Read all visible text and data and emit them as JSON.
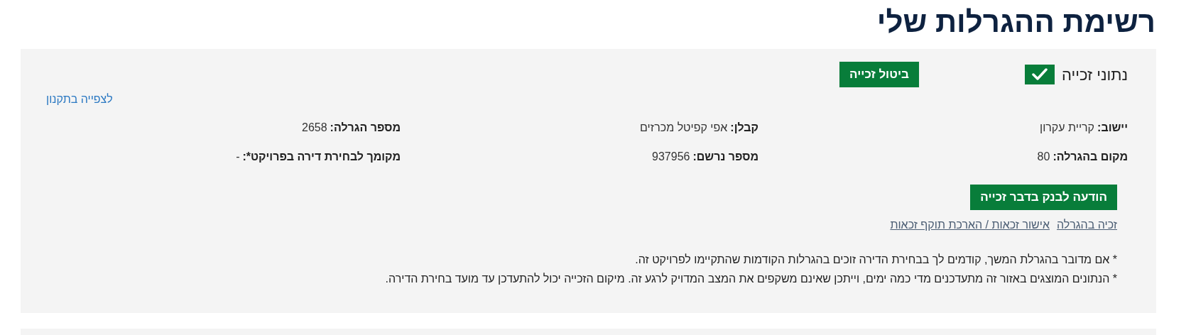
{
  "page_title": "רשימת ההגרלות שלי",
  "win_details": {
    "label": "נתוני זכייה",
    "checked": true
  },
  "cancel_button": "ביטול זכייה",
  "regulations_link": "לצפייה בתקנון",
  "fields": [
    {
      "label": "יישוב:",
      "value": "קריית עקרון"
    },
    {
      "label": "קבלן:",
      "value": "אפי קפיטל מכרזים"
    },
    {
      "label": "מספר הגרלה:",
      "value": "2658"
    },
    {
      "label": "מקום בהגרלה:",
      "value": "80"
    },
    {
      "label": "מספר נרשם:",
      "value": "937956"
    },
    {
      "label": "מקומך לבחירת דירה בפרויקט*:",
      "value": "-"
    }
  ],
  "bank_button": "הודעה לבנק בדבר זכייה",
  "links": [
    "זכיה בהגרלה",
    "אישור זכאות / הארכת תוקף זכאות"
  ],
  "notes": [
    "* אם מדובר בהגרלת המשך, קודמים לך בבחירת הדירה זוכים בהגרלות הקודמות שהתקיימו לפרויקט זה.",
    "* הנתונים המוצגים באזור זה מתעדכנים מדי כמה ימים, וייתכן שאינם משקפים את המצב המדויק לרגע זה. מיקום הזכייה יכול להתעדכן עד מועד בחירת הדירה."
  ]
}
